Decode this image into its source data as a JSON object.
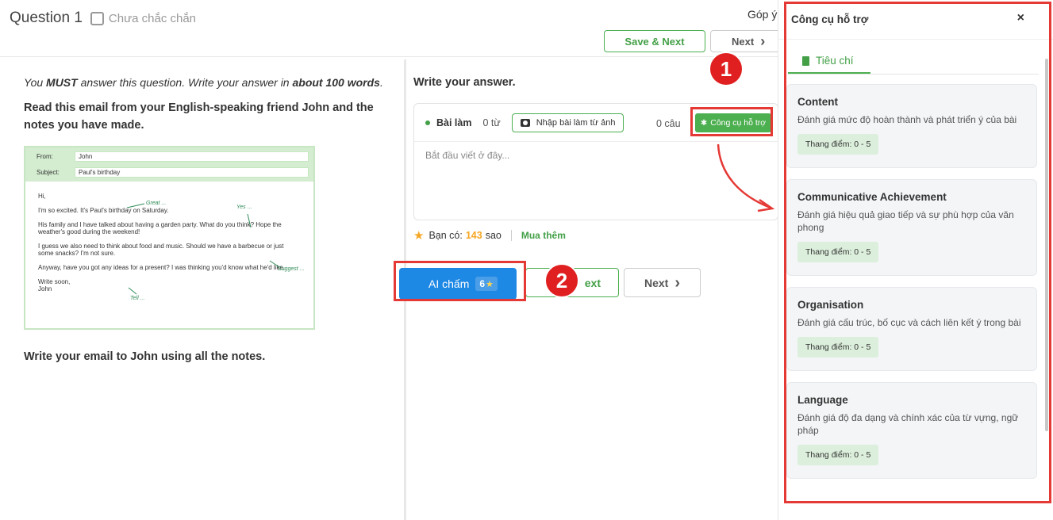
{
  "header": {
    "question_label": "Question 1",
    "unsure_label": "Chưa chắc chắn",
    "feedback_label": "Góp ý",
    "save_next_label": "Save & Next",
    "next_label": "Next",
    "chevron": "›"
  },
  "prompt": {
    "instruction_pre": "You ",
    "instruction_must": "MUST",
    "instruction_mid": " answer this question. Write your answer in ",
    "instruction_words": "about 100 words",
    "instruction_end": ".",
    "read_text": "Read this email from your English-speaking friend John and the notes you have made.",
    "final_text": "Write your email to John using all the notes."
  },
  "email": {
    "from_label": "From:",
    "from_value": "John",
    "subject_label": "Subject:",
    "subject_value": "Paul's birthday",
    "lines": [
      "Hi,",
      "I'm so excited. It's Paul's birthday on Saturday.",
      "His family and I have talked about having a garden party. What do you think? Hope the weather's good during the weekend!",
      "I guess we also need to think about food and music. Should we have a barbecue or just some snacks? I'm not sure.",
      "Anyway, have you got any ideas for a present? I was thinking you'd know what he'd like.",
      "Write soon,",
      "John"
    ],
    "notes": [
      "Great ...",
      "Yes ...",
      "Suggest ...",
      "Tell ..."
    ]
  },
  "answer": {
    "title": "Write your answer.",
    "bai_lam_label": "Bài làm",
    "word_count": "0 từ",
    "import_image_label": "Nhập bài làm từ ảnh",
    "sentence_count": "0 câu",
    "tool_button_label": "Công cụ hỗ trợ",
    "placeholder": "Bắt đầu viết ở đây..."
  },
  "stars": {
    "you_have_label": "Bạn có:",
    "count": "143",
    "unit": "sao",
    "buy_more_label": "Mua thêm"
  },
  "actions": {
    "ai_grade_label": "AI chấm",
    "ai_grade_cost": "6",
    "save_next_partial": "ext",
    "next_label": "Next",
    "chevron": "›"
  },
  "annotations": {
    "step1": "1",
    "step2": "2",
    "highlight_color": "#e53935"
  },
  "panel": {
    "title": "Công cụ hỗ trợ",
    "close": "×",
    "tab_label": "Tiêu chí",
    "criteria": [
      {
        "title": "Content",
        "desc": "Đánh giá mức độ hoàn thành và phát triển ý của bài",
        "scale": "Thang điểm: 0 - 5"
      },
      {
        "title": "Communicative Achievement",
        "desc": "Đánh giá hiệu quả giao tiếp và sự phù hợp của văn phong",
        "scale": "Thang điểm: 0 - 5"
      },
      {
        "title": "Organisation",
        "desc": "Đánh giá cấu trúc, bố cục và cách liên kết ý trong bài",
        "scale": "Thang điểm: 0 - 5"
      },
      {
        "title": "Language",
        "desc": "Đánh giá độ đa dạng và chính xác của từ vựng, ngữ pháp",
        "scale": "Thang điểm: 0 - 5"
      }
    ]
  },
  "colors": {
    "accent_green": "#4caf50",
    "primary_blue": "#1e88e5",
    "star": "#f5a623"
  }
}
